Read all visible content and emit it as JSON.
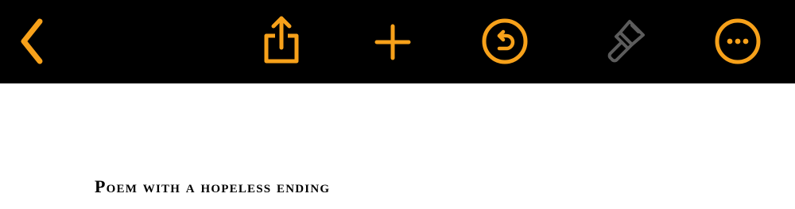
{
  "colors": {
    "toolbar_background": "#000000",
    "accent": "#F7A11A",
    "disabled_icon": "#5C5C5C",
    "page_background": "#FFFFFF",
    "text": "#000000"
  },
  "toolbar": {
    "buttons": [
      {
        "icon": "chevron-left-icon",
        "state": "enabled"
      },
      {
        "icon": "share-icon",
        "state": "enabled"
      },
      {
        "icon": "plus-icon",
        "state": "enabled"
      },
      {
        "icon": "undo-icon",
        "state": "enabled"
      },
      {
        "icon": "paintbrush-icon",
        "state": "disabled"
      },
      {
        "icon": "more-icon",
        "state": "enabled"
      }
    ]
  },
  "document": {
    "title": "Poem with a hopeless ending"
  }
}
